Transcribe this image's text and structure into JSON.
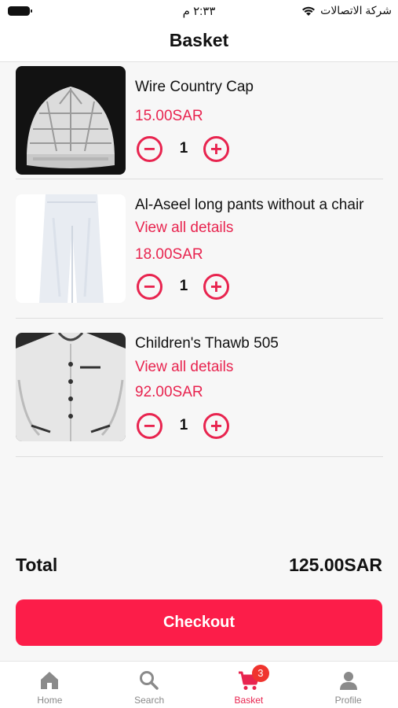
{
  "status_bar": {
    "time": "٢:٣٣ م",
    "carrier": "شركة الاتصالات"
  },
  "header": {
    "title": "Basket"
  },
  "items": [
    {
      "name": "Wire Country Cap",
      "link": "",
      "price": "15.00SAR",
      "qty": "1",
      "image": "white-knit-cap-photo"
    },
    {
      "name": "Al-Aseel long pants without a chair",
      "link": "View all details",
      "price": "18.00SAR",
      "qty": "1",
      "image": "white-pants-photo"
    },
    {
      "name": "Children's Thawb 505",
      "link": "View all details",
      "price": "92.00SAR",
      "qty": "1",
      "image": "white-thawb-photo"
    }
  ],
  "qty_controls": {
    "minus": "−",
    "plus": "+"
  },
  "summary": {
    "total_label": "Total",
    "total_value": "125.00SAR"
  },
  "checkout": {
    "label": "Checkout"
  },
  "tabbar": {
    "tabs": [
      {
        "label": "Home",
        "icon": "home-icon"
      },
      {
        "label": "Search",
        "icon": "search-icon"
      },
      {
        "label": "Basket",
        "icon": "cart-icon",
        "badge": "3"
      },
      {
        "label": "Profile",
        "icon": "profile-icon"
      }
    ]
  },
  "colors": {
    "accent": "#e8244f",
    "checkout": "#fc1d49",
    "badge": "#f0342e"
  }
}
